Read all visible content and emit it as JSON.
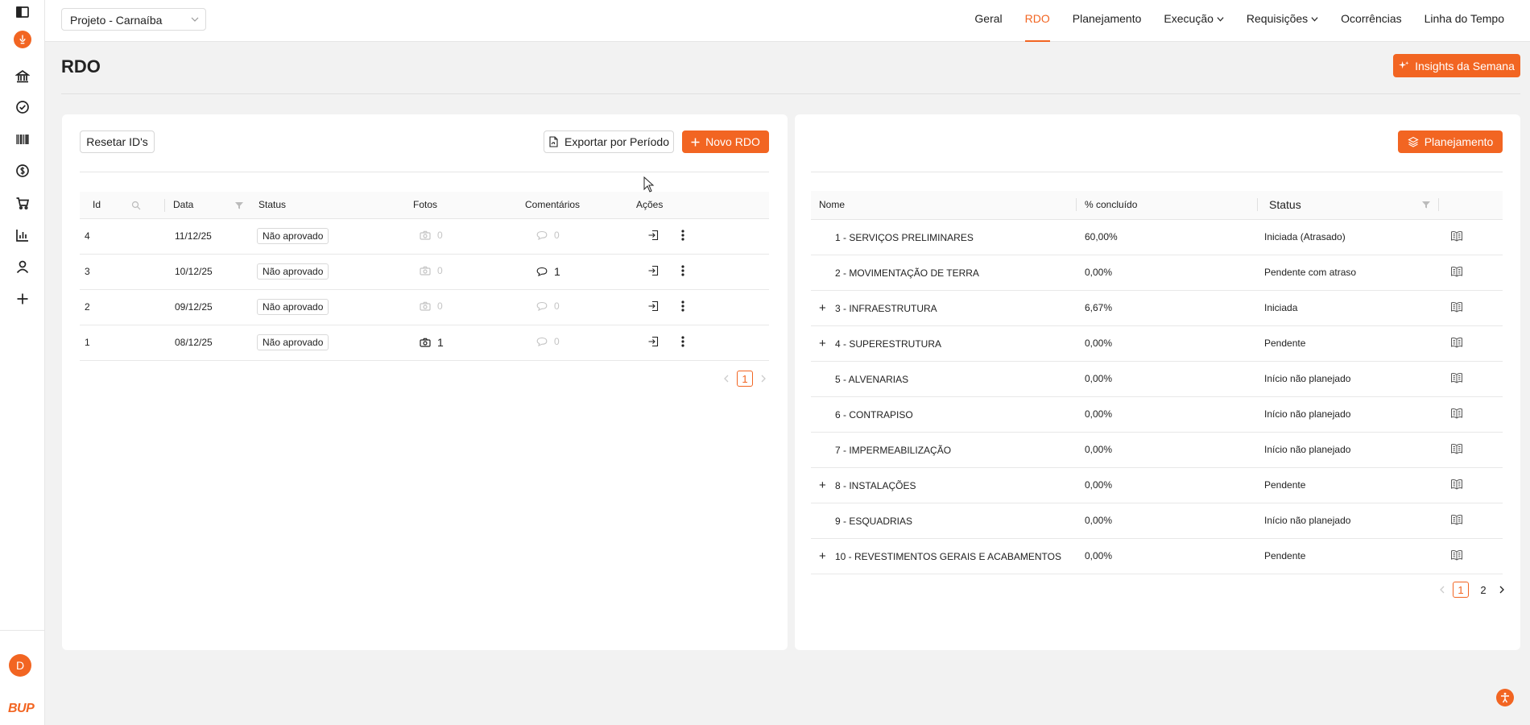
{
  "header": {
    "project_select": "Projeto - Carnaíba",
    "nav": [
      {
        "label": "Geral",
        "active": false,
        "dropdown": false
      },
      {
        "label": "RDO",
        "active": true,
        "dropdown": false
      },
      {
        "label": "Planejamento",
        "active": false,
        "dropdown": false
      },
      {
        "label": "Execução",
        "active": false,
        "dropdown": true
      },
      {
        "label": "Requisições",
        "active": false,
        "dropdown": true
      },
      {
        "label": "Ocorrências",
        "active": false,
        "dropdown": false
      },
      {
        "label": "Linha do Tempo",
        "active": false,
        "dropdown": false
      }
    ]
  },
  "sidebar": {
    "icons": [
      "sidebar-toggle-icon",
      "bank-icon",
      "check-circle-icon",
      "barcode-icon",
      "dollar-icon",
      "cart-icon",
      "bar-chart-icon",
      "user-icon",
      "plus-icon"
    ],
    "avatar_initial": "D",
    "brand": "BUP"
  },
  "page": {
    "title": "RDO",
    "insights_label": "Insights da Semana"
  },
  "rdo": {
    "reset_label": "Resetar ID's",
    "export_label": "Exportar por Período",
    "new_label": "Novo RDO",
    "columns": [
      "Id",
      "Data",
      "Status",
      "Fotos",
      "Comentários",
      "Ações"
    ],
    "rows": [
      {
        "id": "4",
        "date": "11/12/25",
        "status": "Não aprovado",
        "photos": "0",
        "comments": "0"
      },
      {
        "id": "3",
        "date": "10/12/25",
        "status": "Não aprovado",
        "photos": "0",
        "comments": "1"
      },
      {
        "id": "2",
        "date": "09/12/25",
        "status": "Não aprovado",
        "photos": "0",
        "comments": "0"
      },
      {
        "id": "1",
        "date": "08/12/25",
        "status": "Não aprovado",
        "photos": "1",
        "comments": "0"
      }
    ],
    "pages": [
      "1"
    ]
  },
  "plan": {
    "button_label": "Planejamento",
    "columns": [
      "Nome",
      "% concluído",
      "Status"
    ],
    "rows": [
      {
        "expand": false,
        "name": "1 - SERVIÇOS PRELIMINARES",
        "pct": "60,00%",
        "status": "Iniciada (Atrasado)"
      },
      {
        "expand": false,
        "name": "2 - MOVIMENTAÇÃO DE TERRA",
        "pct": "0,00%",
        "status": "Pendente com atraso"
      },
      {
        "expand": true,
        "name": "3 - INFRAESTRUTURA",
        "pct": "6,67%",
        "status": "Iniciada"
      },
      {
        "expand": true,
        "name": "4 - SUPERESTRUTURA",
        "pct": "0,00%",
        "status": "Pendente"
      },
      {
        "expand": false,
        "name": "5 - ALVENARIAS",
        "pct": "0,00%",
        "status": "Início não planejado"
      },
      {
        "expand": false,
        "name": "6 - CONTRAPISO",
        "pct": "0,00%",
        "status": "Início não planejado"
      },
      {
        "expand": false,
        "name": "7 - IMPERMEABILIZAÇÃO",
        "pct": "0,00%",
        "status": "Início não planejado"
      },
      {
        "expand": true,
        "name": "8 - INSTALAÇÕES",
        "pct": "0,00%",
        "status": "Pendente"
      },
      {
        "expand": false,
        "name": "9 - ESQUADRIAS",
        "pct": "0,00%",
        "status": "Início não planejado"
      },
      {
        "expand": true,
        "name": "10 - REVESTIMENTOS GERAIS E ACABAMENTOS",
        "pct": "0,00%",
        "status": "Pendente"
      }
    ],
    "pages": [
      "1",
      "2"
    ]
  },
  "colors": {
    "accent": "#f26522"
  }
}
